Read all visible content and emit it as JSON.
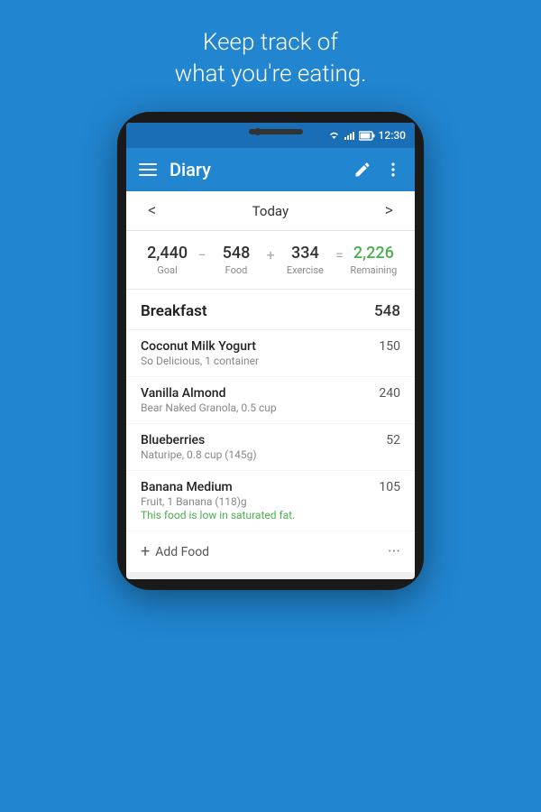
{
  "header": {
    "line1": "Keep track of",
    "line2": "what you're eating."
  },
  "status_bar": {
    "time": "12:30"
  },
  "toolbar": {
    "title": "Diary"
  },
  "date_nav": {
    "label": "Today",
    "prev_arrow": "<",
    "next_arrow": ">"
  },
  "calories": {
    "goal_value": "2,440",
    "goal_label": "Goal",
    "food_value": "548",
    "food_label": "Food",
    "exercise_value": "334",
    "exercise_label": "Exercise",
    "remaining_value": "2,226",
    "remaining_label": "Remaining"
  },
  "meals": [
    {
      "name": "Breakfast",
      "calories": "548",
      "items": [
        {
          "name": "Coconut Milk Yogurt",
          "detail": "So Delicious, 1 container",
          "calories": "150",
          "note": null
        },
        {
          "name": "Vanilla Almond",
          "detail": "Bear Naked Granola, 0.5 cup",
          "calories": "240",
          "note": null
        },
        {
          "name": "Blueberries",
          "detail": "Naturipe, 0.8 cup (145g)",
          "calories": "52",
          "note": null
        },
        {
          "name": "Banana Medium",
          "detail": "Fruit, 1 Banana (118)g",
          "calories": "105",
          "note": "This food is low in saturated fat."
        }
      ],
      "add_food_label": "Add Food"
    }
  ]
}
